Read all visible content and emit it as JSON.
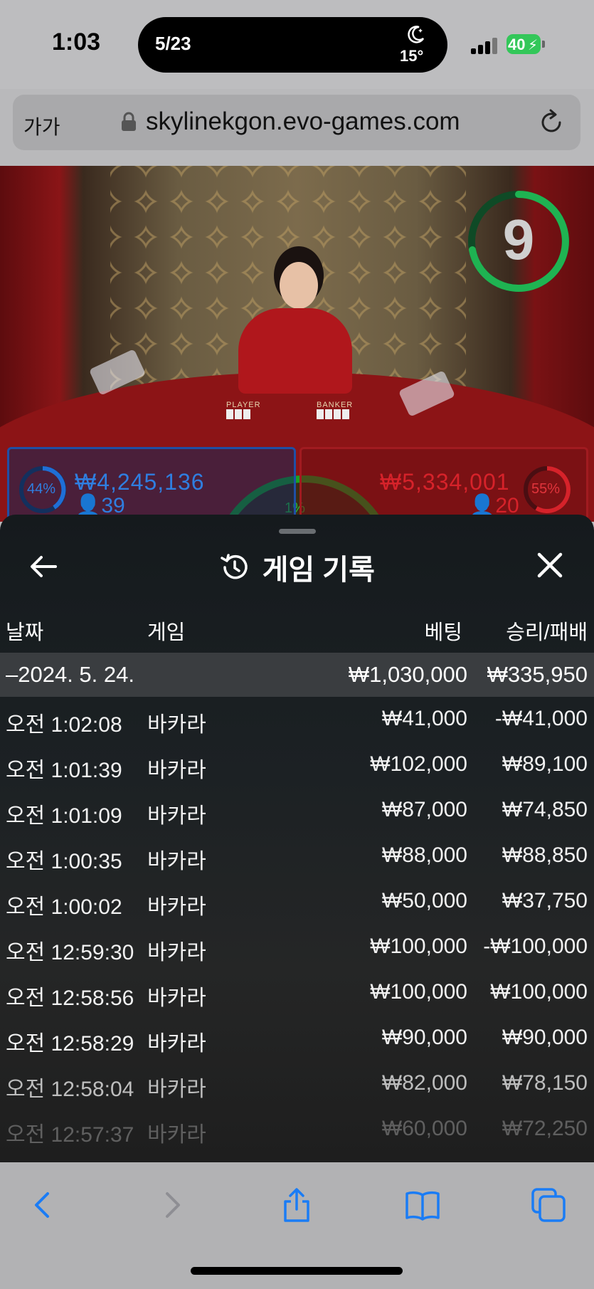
{
  "status_bar": {
    "time": "1:03",
    "island_date": "5/23",
    "temperature": "15°",
    "battery": "40"
  },
  "url_bar": {
    "text_size": "가가",
    "url": "skylinekgon.evo-games.com"
  },
  "video": {
    "timer": "9",
    "player": {
      "percent": "44%",
      "amount": "₩4,245,136",
      "count": "39",
      "color": "#1f6fd6"
    },
    "banker": {
      "percent": "55%",
      "amount": "₩5,334,001",
      "count": "20",
      "color": "#d6222a"
    },
    "tie": {
      "percent": "1%",
      "color": "#25c33a"
    },
    "table_labels": {
      "player": "PLAYER",
      "banker": "BANKER"
    }
  },
  "sheet": {
    "title": "게임 기록",
    "columns": {
      "date": "날짜",
      "game": "게임",
      "bet": "베팅",
      "result": "승리/패배"
    },
    "summary": {
      "date": "–2024. 5. 24.",
      "bet": "₩1,030,000",
      "result": "₩335,950"
    },
    "rows": [
      {
        "time": "오전 1:02:08",
        "game": "바카라",
        "bet": "₩41,000",
        "result": "-₩41,000"
      },
      {
        "time": "오전 1:01:39",
        "game": "바카라",
        "bet": "₩102,000",
        "result": "₩89,100"
      },
      {
        "time": "오전 1:01:09",
        "game": "바카라",
        "bet": "₩87,000",
        "result": "₩74,850"
      },
      {
        "time": "오전 1:00:35",
        "game": "바카라",
        "bet": "₩88,000",
        "result": "₩88,850"
      },
      {
        "time": "오전 1:00:02",
        "game": "바카라",
        "bet": "₩50,000",
        "result": "₩37,750"
      },
      {
        "time": "오전 12:59:30",
        "game": "바카라",
        "bet": "₩100,000",
        "result": "-₩100,000"
      },
      {
        "time": "오전 12:58:56",
        "game": "바카라",
        "bet": "₩100,000",
        "result": "₩100,000"
      },
      {
        "time": "오전 12:58:29",
        "game": "바카라",
        "bet": "₩90,000",
        "result": "₩90,000"
      },
      {
        "time": "오전 12:58:04",
        "game": "바카라",
        "bet": "₩82,000",
        "result": "₩78,150"
      },
      {
        "time": "오전 12:57:37",
        "game": "바카라",
        "bet": "₩60,000",
        "result": "₩72,250"
      }
    ]
  },
  "toolbar": {
    "accent": "#1a7cf5",
    "icons": [
      "back-icon",
      "forward-icon",
      "share-icon",
      "bookmarks-icon",
      "tabs-icon"
    ]
  }
}
